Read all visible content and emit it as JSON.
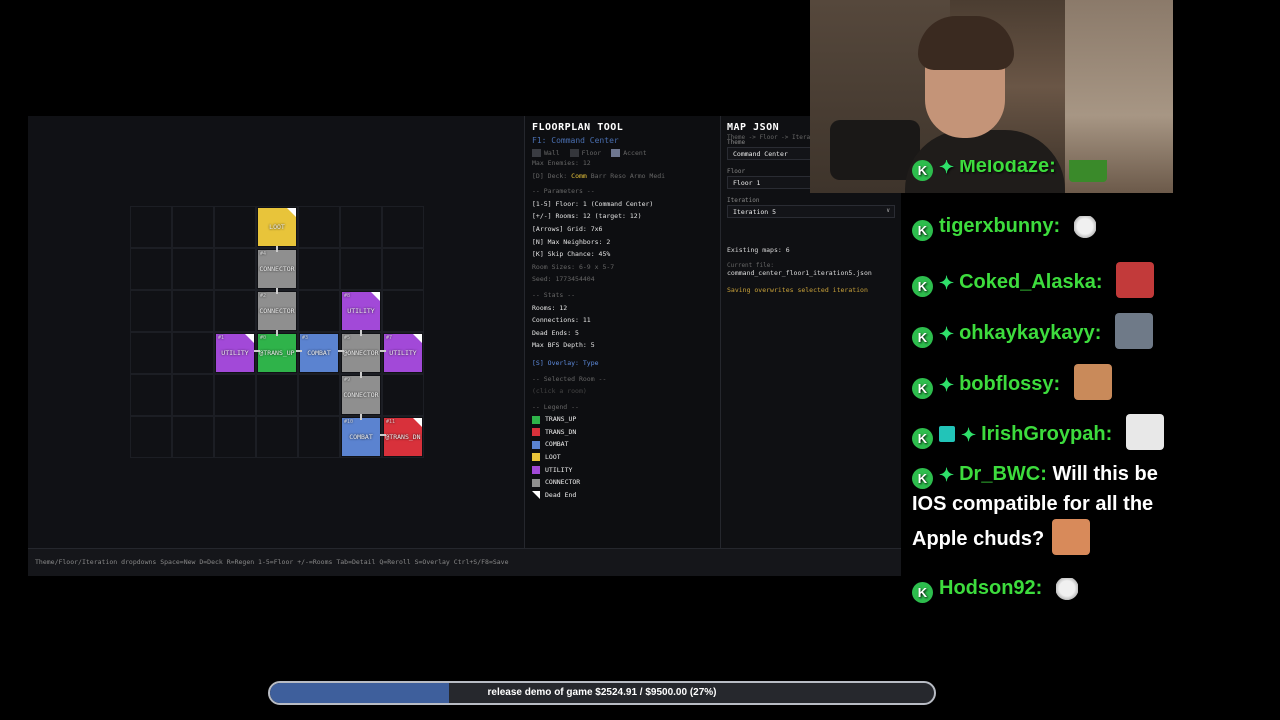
{
  "colors": {
    "trans_up": "#2fb34a",
    "trans_dn": "#d8313b",
    "combat": "#5b83d0",
    "loot": "#e8c43a",
    "utility": "#a249d8",
    "connector": "#8f8f8f",
    "dead_end": "#ffffff"
  },
  "grid_rooms": [
    {
      "id": "",
      "label": "LOOT",
      "type": "loot",
      "dead": true
    },
    {
      "id": "#4",
      "label": "CONNECTOR",
      "type": "connector",
      "dead": false
    },
    {
      "id": "#2",
      "label": "CONNECTOR",
      "type": "connector",
      "dead": false
    },
    {
      "id": "#8",
      "label": "UTILITY",
      "type": "utility",
      "dead": true
    },
    {
      "id": "#1",
      "label": "UTILITY",
      "type": "utility",
      "dead": true
    },
    {
      "id": "#0",
      "label": "@TRANS_UP",
      "type": "trans_up",
      "dead": false
    },
    {
      "id": "#3",
      "label": "COMBAT",
      "type": "combat",
      "dead": false
    },
    {
      "id": "#5",
      "label": "@ONNECTOR",
      "type": "connector",
      "dead": false
    },
    {
      "id": "#7",
      "label": "UTILITY",
      "type": "utility",
      "dead": true
    },
    {
      "id": "#9",
      "label": "CONNECTOR",
      "type": "connector",
      "dead": false
    },
    {
      "id": "#10",
      "label": "COMBAT",
      "type": "combat",
      "dead": false
    },
    {
      "id": "#11",
      "label": "@TRANS_DN",
      "type": "trans_dn",
      "dead": true
    }
  ],
  "info": {
    "title": "FLOORPLAN TOOL",
    "floor_name": "F1: Command Center",
    "swatch_wall": "Wall",
    "swatch_floor": "Floor",
    "swatch_accent": "Accent",
    "max_enemies": "Max Enemies: 12",
    "deck_label": "[D] Deck:",
    "deck_active": "Comm",
    "deck_rest": "Barr Reso Armo Medi",
    "params_header": "-- Parameters --",
    "p1": "[1-5] Floor: 1 (Command Center)",
    "p2": "[+/-] Rooms: 12 (target: 12)",
    "p3": "[Arrows] Grid: 7x6",
    "p4": "[N] Max Neighbors: 2",
    "p5": "[K] Skip Chance: 45%",
    "p6": "Room Sizes: 6-9 x 5-7",
    "p7": "Seed: 1773454404",
    "stats_header": "-- Stats --",
    "s1": "Rooms: 12",
    "s2": "Connections: 11",
    "s3": "Dead Ends: 5",
    "s4": "Max BFS Depth: 5",
    "overlay": "[S] Overlay: Type",
    "selected_header": "-- Selected Room --",
    "selected_hint": "(click a room)",
    "legend_header": "-- Legend --",
    "legend": [
      {
        "label": "TRANS_UP",
        "color": "#2fb34a"
      },
      {
        "label": "TRANS_DN",
        "color": "#d8313b"
      },
      {
        "label": "COMBAT",
        "color": "#5b83d0"
      },
      {
        "label": "LOOT",
        "color": "#e8c43a"
      },
      {
        "label": "UTILITY",
        "color": "#a249d8"
      },
      {
        "label": "CONNECTOR",
        "color": "#8f8f8f"
      },
      {
        "label": "Dead End",
        "color": "#ffffff"
      }
    ]
  },
  "json_panel": {
    "title": "MAP JSON",
    "breadcrumb": "Theme -> Floor -> Itera",
    "theme_label": "Theme",
    "theme_value": "Command Center",
    "floor_label": "Floor",
    "floor_value": "Floor 1",
    "iteration_label": "Iteration",
    "iteration_value": "Iteration 5",
    "existing": "Existing maps: 6",
    "current_label": "Current file:",
    "current_file": "command_center_floor1_iteration5.json",
    "save_note": "Saving overwrites selected iteration"
  },
  "status_bar": "Theme/Floor/Iteration dropdowns  Space=New  D=Deck  R=Regen  1-5=Floor  +/-=Rooms  Tab=Detail  Q=Reroll  S=Overlay  Ctrl+S/F8=Save",
  "chat": [
    {
      "user": "Melodaze:",
      "text": "",
      "badges": [
        "k",
        "sparkle"
      ],
      "emote": "#3a8a2a"
    },
    {
      "user": "tigerxbunny:",
      "text": "",
      "badges": [
        "k"
      ],
      "emote_small": true
    },
    {
      "user": "Coked_Alaska:",
      "text": "",
      "badges": [
        "k",
        "sparkle"
      ],
      "emote": "#c23a3a"
    },
    {
      "user": "ohkaykaykayy:",
      "text": "",
      "badges": [
        "k",
        "sparkle"
      ],
      "emote": "#6f7a88"
    },
    {
      "user": "bobflossy:",
      "text": "",
      "badges": [
        "k",
        "sparkle"
      ],
      "emote": "#c98a5a"
    },
    {
      "user": "IrishGroypah:",
      "text": "",
      "badges": [
        "k",
        "gift",
        "sparkle"
      ],
      "emote": "#e8e8e8"
    },
    {
      "user": "Dr_BWC:",
      "text": "Will this be IOS compatible for all the Apple chuds?",
      "badges": [
        "k",
        "sparkle"
      ],
      "emote": "#d88a5a"
    },
    {
      "user": "Hodson92:",
      "text": "",
      "badges": [
        "k"
      ],
      "emote_small": true
    }
  ],
  "goal": {
    "text": "release demo of game $2524.91 / $9500.00 (27%)",
    "progress": 0.27
  }
}
